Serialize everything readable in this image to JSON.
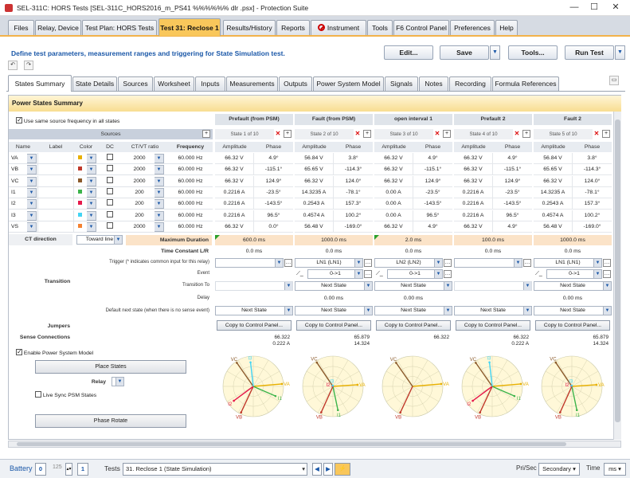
{
  "window": {
    "title": "SEL-311C: HORS Tests [SEL-311C_HORS2016_m_PS41 %%%%%% dlr .psx] - Protection Suite",
    "controls": [
      "—",
      "☐",
      "✕"
    ]
  },
  "main_tabs": [
    "Files",
    "Relay, Device",
    "Test Plan: HORS Tests",
    "Test 31: Reclose 1",
    "Results/History",
    "Reports",
    "Instrument",
    "Tools",
    "F6 Control Panel",
    "Preferences",
    "Help"
  ],
  "instruction": "Define test parameters, measurement ranges and triggering for State Simulation test.",
  "toolbar": {
    "edit": "Edit...",
    "save": "Save",
    "tools": "Tools...",
    "run": "Run Test"
  },
  "sub_tabs": [
    "States Summary",
    "State Details",
    "Sources",
    "Worksheet",
    "Inputs",
    "Measurements",
    "Outputs",
    "Power System Model",
    "Signals",
    "Notes",
    "Recording",
    "Formula References"
  ],
  "summary": {
    "header": "Power States Summary",
    "same_freq_label": "Use same source frequency in all states",
    "sources_label": "Sources",
    "columns": [
      "Name",
      "Label",
      "Color",
      "DC",
      "CT/VT ratio",
      "Frequency"
    ],
    "sources": [
      {
        "name": "VA",
        "ratio": "2000",
        "freq": "60.000 Hz",
        "color": "#e8b000"
      },
      {
        "name": "VB",
        "ratio": "2000",
        "freq": "60.000 Hz",
        "color": "#c0392b"
      },
      {
        "name": "VC",
        "ratio": "2000",
        "freq": "60.000 Hz",
        "color": "#8b5a2b"
      },
      {
        "name": "I1",
        "ratio": "200",
        "freq": "60.000 Hz",
        "color": "#3cb44b"
      },
      {
        "name": "I2",
        "ratio": "200",
        "freq": "60.000 Hz",
        "color": "#e6194b"
      },
      {
        "name": "I3",
        "ratio": "200",
        "freq": "60.000 Hz",
        "color": "#42d4f4"
      },
      {
        "name": "VS",
        "ratio": "2000",
        "freq": "60.000 Hz",
        "color": "#f58231"
      }
    ],
    "amp_label": "Amplitude",
    "phase_label": "Phase",
    "states": [
      {
        "title": "Prefault (from PSM)",
        "sub": "State 1 of 10",
        "amp": [
          "66.32 V",
          "66.32 V",
          "66.32 V",
          "0.2216 A",
          "0.2216 A",
          "0.2216 A",
          "66.32 V"
        ],
        "ph": [
          "4.9°",
          "-115.1°",
          "124.9°",
          "-23.5°",
          "-143.5°",
          "96.5°",
          "0.0°"
        ],
        "duration": "600.0 ms",
        "tc": "0.0 ms",
        "trigger": "",
        "event": "",
        "transition_to": "",
        "delay": "",
        "default_next": "Next State",
        "magnitudes": [
          "66.322",
          "0.222 A"
        ]
      },
      {
        "title": "Fault (from PSM)",
        "sub": "State 2 of 10",
        "amp": [
          "56.84 V",
          "65.65 V",
          "66.32 V",
          "14.3235 A",
          "0.2543 A",
          "0.4574 A",
          "56.48 V"
        ],
        "ph": [
          "3.8°",
          "-114.3°",
          "124.0°",
          "-78.1°",
          "157.3°",
          "100.2°",
          "-169.0°"
        ],
        "duration": "1000.0 ms",
        "tc": "0.0 ms",
        "trigger": "LN1 (LN1)",
        "event": "0->1",
        "transition_to": "Next State",
        "delay": "0.00 ms",
        "default_next": "Next State",
        "magnitudes": [
          "65.879",
          "14.324"
        ]
      },
      {
        "title": "open interval 1",
        "sub": "State 3 of 10",
        "amp": [
          "66.32 V",
          "66.32 V",
          "66.32 V",
          "0.00 A",
          "0.00 A",
          "0.00 A",
          "66.32 V"
        ],
        "ph": [
          "4.9°",
          "-115.1°",
          "124.9°",
          "-23.5°",
          "-143.5°",
          "96.5°",
          "4.9°"
        ],
        "duration": "2.0 ms",
        "tc": "0.0 ms",
        "trigger": "LN2 (LN2)",
        "event": "0->1",
        "transition_to": "Next State",
        "delay": "0.00 ms",
        "default_next": "Next State",
        "magnitudes": [
          "66.322",
          ""
        ]
      },
      {
        "title": "Prefault 2",
        "sub": "State 4 of 10",
        "amp": [
          "66.32 V",
          "66.32 V",
          "66.32 V",
          "0.2216 A",
          "0.2216 A",
          "0.2216 A",
          "66.32 V"
        ],
        "ph": [
          "4.9°",
          "-115.1°",
          "124.9°",
          "-23.5°",
          "-143.5°",
          "96.5°",
          "4.9°"
        ],
        "duration": "100.0 ms",
        "tc": "0.0 ms",
        "trigger": "",
        "event": "",
        "transition_to": "",
        "delay": "",
        "default_next": "Next State",
        "magnitudes": [
          "66.322",
          "0.222 A"
        ]
      },
      {
        "title": "Fault 2",
        "sub": "State 5 of 10",
        "amp": [
          "56.84 V",
          "65.65 V",
          "66.32 V",
          "14.3235 A",
          "0.2543 A",
          "0.4574 A",
          "56.48 V"
        ],
        "ph": [
          "3.8°",
          "-114.3°",
          "124.0°",
          "-78.1°",
          "157.3°",
          "100.2°",
          "-169.0°"
        ],
        "duration": "1000.0 ms",
        "tc": "0.0 ms",
        "trigger": "LN1 (LN1)",
        "event": "0->1",
        "transition_to": "Next State",
        "delay": "0.00 ms",
        "default_next": "Next State",
        "magnitudes": [
          "65.879",
          "14.324"
        ]
      }
    ],
    "ct_direction_label": "CT direction",
    "ct_direction_value": "Toward line",
    "max_duration_label": "Maximum Duration",
    "time_constant_label": "Time Constant L/R",
    "transition_label": "Transition",
    "trigger_label": "Trigger (* indicates common input for this relay)",
    "event_label": "Event",
    "transition_to_label": "Transition To",
    "delay_label": "Delay",
    "default_next_label": "Default next state (when there is no sense event)",
    "jumpers_label": "Jumpers",
    "sense_label": "Sense Connections",
    "copy_btn": "Copy to Control Panel...",
    "enable_psm_label": "Enable Power System Model",
    "place_states_btn": "Place States",
    "relay_label": "Relay",
    "live_sync_label": "Live Sync PSM States",
    "phase_rotate_btn": "Phase Rotate",
    "phasor_labels": {
      "va": "VA",
      "vb": "VB",
      "vc": "VC",
      "i1": "I1",
      "i2": "I2",
      "i3": "I3"
    }
  },
  "status": {
    "battery_label": "Battery",
    "battery_value": "0",
    "battery_count": "125",
    "battery_sel": "1",
    "tests_label": "Tests",
    "test_selected": "31. Reclose 1 (State Simulation)",
    "prisec_label": "Pri/Sec",
    "prisec_value": "Secondary",
    "time_label": "Time",
    "time_value": "ms"
  }
}
